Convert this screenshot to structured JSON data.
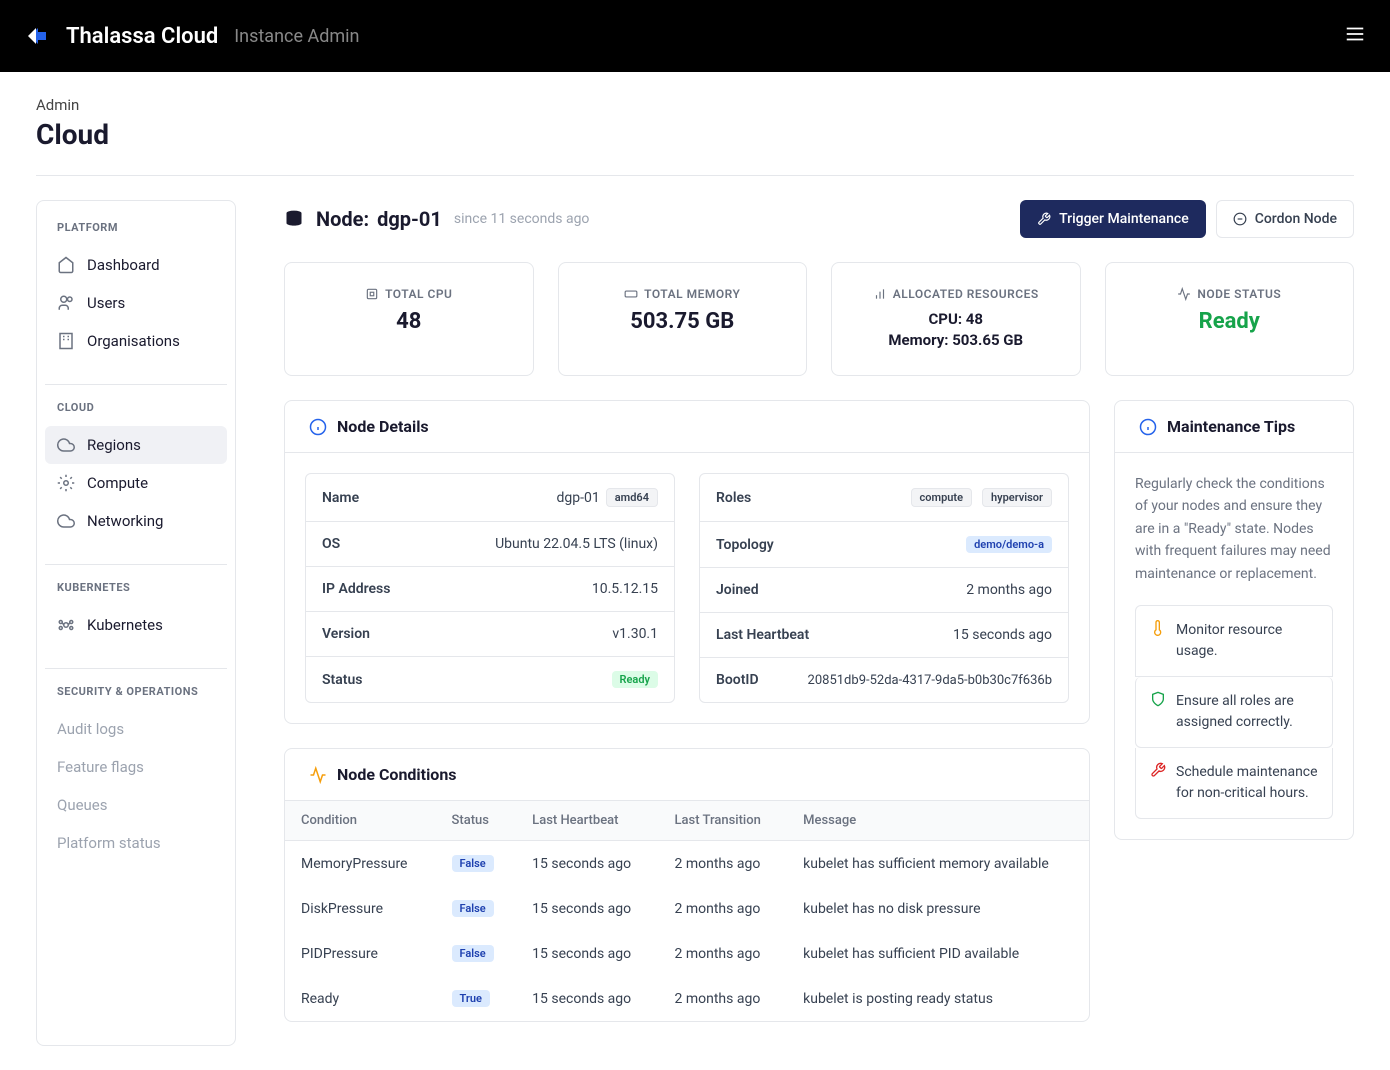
{
  "header": {
    "brand": "Thalassa Cloud",
    "subtitle": "Instance Admin"
  },
  "page": {
    "breadcrumb": "Admin",
    "title": "Cloud"
  },
  "sidebar": {
    "sections": [
      {
        "title": "PLATFORM",
        "items": [
          {
            "label": "Dashboard",
            "icon": "home"
          },
          {
            "label": "Users",
            "icon": "users"
          },
          {
            "label": "Organisations",
            "icon": "building"
          }
        ]
      },
      {
        "title": "CLOUD",
        "items": [
          {
            "label": "Regions",
            "icon": "cloud",
            "active": true
          },
          {
            "label": "Compute",
            "icon": "gear"
          },
          {
            "label": "Networking",
            "icon": "cloud"
          }
        ]
      },
      {
        "title": "KUBERNETES",
        "items": [
          {
            "label": "Kubernetes",
            "icon": "k8s"
          }
        ]
      },
      {
        "title": "SECURITY & OPERATIONS",
        "items": [
          {
            "label": "Audit logs",
            "disabled": true
          },
          {
            "label": "Feature flags",
            "disabled": true
          },
          {
            "label": "Queues",
            "disabled": true
          },
          {
            "label": "Platform status",
            "disabled": true
          }
        ]
      }
    ]
  },
  "node": {
    "title_prefix": "Node: ",
    "name": "dgp-01",
    "since": "since 11 seconds ago",
    "actions": {
      "trigger": "Trigger Maintenance",
      "cordon": "Cordon Node"
    }
  },
  "stats": {
    "cpu_label": "TOTAL CPU",
    "cpu_value": "48",
    "mem_label": "TOTAL MEMORY",
    "mem_value": "503.75 GB",
    "alloc_label": "ALLOCATED RESOURCES",
    "alloc_cpu": "CPU: 48",
    "alloc_mem": "Memory: 503.65 GB",
    "status_label": "NODE STATUS",
    "status_value": "Ready"
  },
  "details": {
    "title": "Node Details",
    "left": {
      "name_k": "Name",
      "name_v": "dgp-01",
      "arch": "amd64",
      "os_k": "OS",
      "os_v": "Ubuntu 22.04.5 LTS (linux)",
      "ip_k": "IP Address",
      "ip_v": "10.5.12.15",
      "ver_k": "Version",
      "ver_v": "v1.30.1",
      "status_k": "Status",
      "status_v": "Ready"
    },
    "right": {
      "roles_k": "Roles",
      "role1": "compute",
      "role2": "hypervisor",
      "topo_k": "Topology",
      "topo_v": "demo/demo-a",
      "joined_k": "Joined",
      "joined_v": "2 months ago",
      "hb_k": "Last Heartbeat",
      "hb_v": "15 seconds ago",
      "boot_k": "BootID",
      "boot_v": "20851db9-52da-4317-9da5-b0b30c7f636b"
    }
  },
  "tips": {
    "title": "Maintenance Tips",
    "intro": "Regularly check the conditions of your nodes and ensure they are in a \"Ready\" state. Nodes with frequent failures may need maintenance or replacement.",
    "items": [
      "Monitor resource usage.",
      "Ensure all roles are assigned correctly.",
      "Schedule maintenance for non-critical hours."
    ]
  },
  "conditions": {
    "title": "Node Conditions",
    "cols": {
      "c1": "Condition",
      "c2": "Status",
      "c3": "Last Heartbeat",
      "c4": "Last Transition",
      "c5": "Message"
    },
    "rows": [
      {
        "cond": "MemoryPressure",
        "status": "False",
        "hb": "15 seconds ago",
        "tr": "2 months ago",
        "msg": "kubelet has sufficient memory available"
      },
      {
        "cond": "DiskPressure",
        "status": "False",
        "hb": "15 seconds ago",
        "tr": "2 months ago",
        "msg": "kubelet has no disk pressure"
      },
      {
        "cond": "PIDPressure",
        "status": "False",
        "hb": "15 seconds ago",
        "tr": "2 months ago",
        "msg": "kubelet has sufficient PID available"
      },
      {
        "cond": "Ready",
        "status": "True",
        "hb": "15 seconds ago",
        "tr": "2 months ago",
        "msg": "kubelet is posting ready status"
      }
    ]
  }
}
